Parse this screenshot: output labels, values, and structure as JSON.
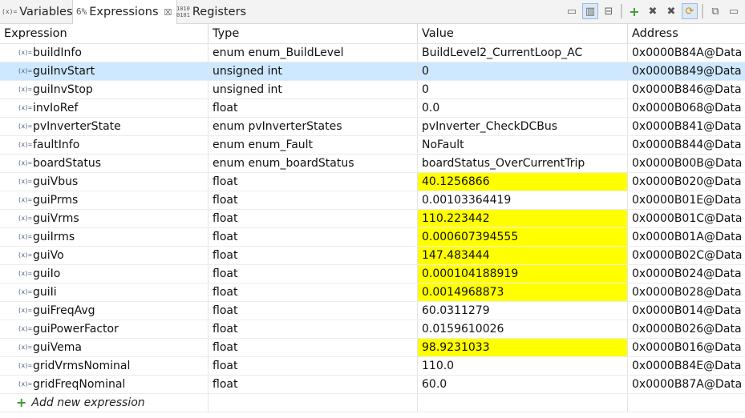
{
  "tabs": [
    {
      "icon": "(x)=",
      "label": "Variables",
      "active": false
    },
    {
      "icon": "6%",
      "label": "Expressions",
      "active": true,
      "close": "☒"
    },
    {
      "icon": "1010\n0101",
      "label": "Registers",
      "active": false
    }
  ],
  "toolbar": {
    "buttons": [
      {
        "name": "show-type-names-icon"
      },
      {
        "name": "select-columns-icon",
        "pressed": true
      },
      {
        "name": "collapse-all-icon"
      },
      {
        "name": "add-expression-icon"
      },
      {
        "name": "remove-expression-icon"
      },
      {
        "name": "remove-all-expressions-icon"
      },
      {
        "name": "continuous-refresh-icon",
        "pressed": true
      },
      {
        "name": "new-window-icon"
      },
      {
        "name": "view-menu-icon"
      }
    ]
  },
  "columns": [
    "Expression",
    "Type",
    "Value",
    "Address"
  ],
  "rows": [
    {
      "expr": "buildInfo",
      "type": "enum enum_BuildLevel",
      "value": "BuildLevel2_CurrentLoop_AC",
      "address": "0x0000B84A@Data",
      "highlight": false,
      "selected": false
    },
    {
      "expr": "guiInvStart",
      "type": "unsigned int",
      "value": "0",
      "address": "0x0000B849@Data",
      "highlight": false,
      "selected": true
    },
    {
      "expr": "guiInvStop",
      "type": "unsigned int",
      "value": "0",
      "address": "0x0000B846@Data",
      "highlight": false,
      "selected": false
    },
    {
      "expr": "invIoRef",
      "type": "float",
      "value": "0.0",
      "address": "0x0000B068@Data",
      "highlight": false,
      "selected": false
    },
    {
      "expr": "pvInverterState",
      "type": "enum pvInverterStates",
      "value": "pvInverter_CheckDCBus",
      "address": "0x0000B841@Data",
      "highlight": false,
      "selected": false
    },
    {
      "expr": "faultInfo",
      "type": "enum enum_Fault",
      "value": "NoFault",
      "address": "0x0000B844@Data",
      "highlight": false,
      "selected": false
    },
    {
      "expr": "boardStatus",
      "type": "enum enum_boardStatus",
      "value": "boardStatus_OverCurrentTrip",
      "address": "0x0000B00B@Data",
      "highlight": false,
      "selected": false
    },
    {
      "expr": "guiVbus",
      "type": "float",
      "value": "40.1256866",
      "address": "0x0000B020@Data",
      "highlight": true,
      "selected": false
    },
    {
      "expr": "guiPrms",
      "type": "float",
      "value": "0.00103364419",
      "address": "0x0000B01E@Data",
      "highlight": false,
      "selected": false
    },
    {
      "expr": "guiVrms",
      "type": "float",
      "value": "110.223442",
      "address": "0x0000B01C@Data",
      "highlight": true,
      "selected": false
    },
    {
      "expr": "guiIrms",
      "type": "float",
      "value": "0.000607394555",
      "address": "0x0000B01A@Data",
      "highlight": true,
      "selected": false
    },
    {
      "expr": "guiVo",
      "type": "float",
      "value": "147.483444",
      "address": "0x0000B02C@Data",
      "highlight": true,
      "selected": false
    },
    {
      "expr": "guiIo",
      "type": "float",
      "value": "0.000104188919",
      "address": "0x0000B024@Data",
      "highlight": true,
      "selected": false
    },
    {
      "expr": "guiIi",
      "type": "float",
      "value": "0.0014968873",
      "address": "0x0000B028@Data",
      "highlight": true,
      "selected": false
    },
    {
      "expr": "guiFreqAvg",
      "type": "float",
      "value": "60.0311279",
      "address": "0x0000B014@Data",
      "highlight": false,
      "selected": false
    },
    {
      "expr": "guiPowerFactor",
      "type": "float",
      "value": "0.0159610026",
      "address": "0x0000B026@Data",
      "highlight": false,
      "selected": false
    },
    {
      "expr": "guiVema",
      "type": "float",
      "value": "98.9231033",
      "address": "0x0000B016@Data",
      "highlight": true,
      "selected": false
    },
    {
      "expr": "gridVrmsNominal",
      "type": "float",
      "value": "110.0",
      "address": "0x0000B84E@Data",
      "highlight": false,
      "selected": false
    },
    {
      "expr": "gridFreqNominal",
      "type": "float",
      "value": "60.0",
      "address": "0x0000B87A@Data",
      "highlight": false,
      "selected": false
    }
  ],
  "row_icon": "(x)=",
  "add_row": {
    "label": "Add new expression"
  },
  "colors": {
    "highlight": "#ffff00",
    "selected": "#cde8ff"
  }
}
